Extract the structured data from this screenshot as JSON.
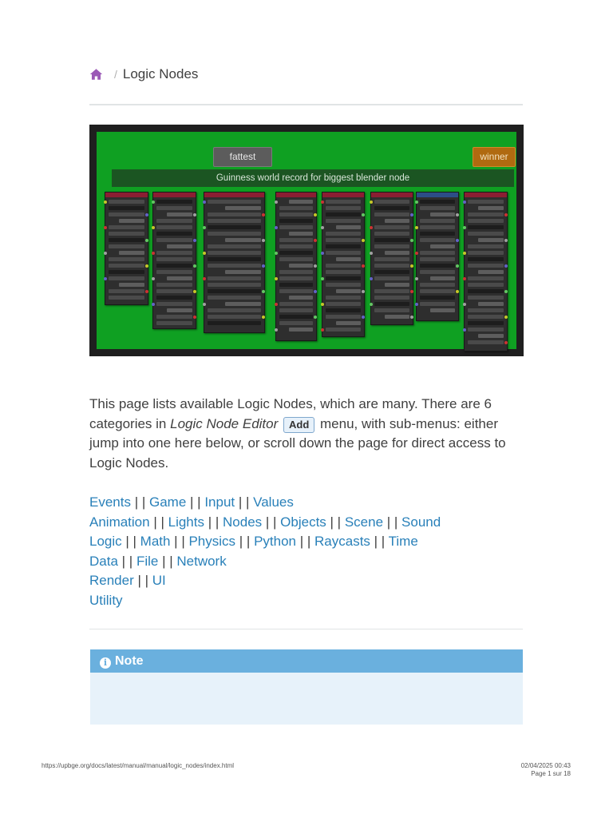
{
  "breadcrumb": {
    "current": "Logic Nodes",
    "separator": "/"
  },
  "hero": {
    "tag_left": "fattest",
    "tag_right": "winner",
    "frame_title": "Guinness world record for biggest blender node"
  },
  "intro": {
    "part1": "This page lists available Logic Nodes, which are many. There are 6 categories in ",
    "editor": "Logic Node Editor",
    "button": "Add",
    "part2": " menu, with sub-menus: either jump into one here below, or scroll down the page for direct access to Logic Nodes."
  },
  "separator": " | | ",
  "link_rows": [
    [
      "Events",
      "Game",
      "Input",
      "Values"
    ],
    [
      "Animation",
      "Lights",
      "Nodes",
      "Objects",
      "Scene",
      "Sound"
    ],
    [
      "Logic",
      "Math",
      "Physics",
      "Python",
      "Raycasts",
      "Time"
    ],
    [
      "Data",
      "File",
      "Network"
    ],
    [
      "Render",
      "UI"
    ],
    [
      "Utility"
    ]
  ],
  "note": {
    "title": "Note"
  },
  "footer": {
    "url": "https://upbge.org/docs/latest/manual/manual/logic_nodes/index.html",
    "datetime": "02/04/2025 00:43",
    "page": "Page 1 sur 18"
  },
  "colors": {
    "link": "#2980b9",
    "home_icon": "#9b59b6",
    "note_title_bg": "#6ab0de",
    "note_body_bg": "#e7f2fa",
    "editor_green": "#0fa022"
  }
}
